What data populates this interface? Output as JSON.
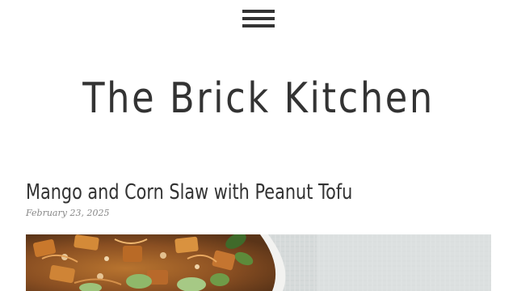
{
  "header": {
    "menu_icon": "hamburger-menu-icon",
    "site_title": "The Brick Kitchen"
  },
  "post": {
    "title": "Mango and Corn Slaw with Peanut Tofu",
    "date": "February 23, 2025",
    "image": {
      "subject": "salad-bowl-photo"
    }
  },
  "colors": {
    "text": "#333333",
    "date": "#888888",
    "background": "#ffffff"
  }
}
